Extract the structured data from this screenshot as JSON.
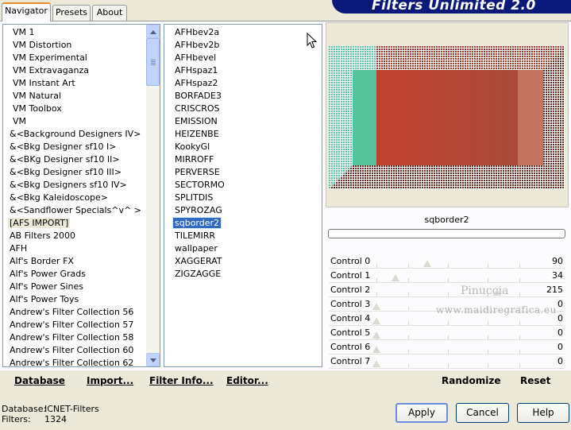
{
  "tabs": [
    "Navigator",
    "Presets",
    "About"
  ],
  "banner_title": "Filters Unlimited 2.0",
  "categories": [
    "VM 1",
    "VM Distortion",
    "VM Experimental",
    "VM Extravaganza",
    "VM Instant Art",
    "VM Natural",
    "VM Toolbox",
    "VM",
    "&<Background Designers IV>",
    "&<Bkg Designer sf10 I>",
    "&<BKg Designer sf10 II>",
    "&<Bkg Designer sf10 III>",
    "&<Bkg Designers sf10 IV>",
    "&<Bkg Kaleidoscope>",
    "&<Sandflower Specials^v^ >",
    "[AFS IMPORT]",
    "AB Filters 2000",
    "AFH",
    "Alf's Border FX",
    "Alf's Power Grads",
    "Alf's Power Sines",
    "Alf's Power Toys",
    "Andrew's Filter Collection 56",
    "Andrew's Filter Collection 57",
    "Andrew's Filter Collection 58",
    "Andrew's Filter Collection 60",
    "Andrew's Filter Collection 62"
  ],
  "filters": [
    "AFHbev2a",
    "AFHbev2b",
    "AFHbevel",
    "AFHspaz1",
    "AFHspaz2",
    "BORFADE3",
    "CRISCROS",
    "EMISSION",
    "HEIZENBE",
    "KookyGl",
    "MIRROFF",
    "PERVERSE",
    "SECTORMO",
    "SPLITDIS",
    "SPYROZAG",
    "sqborder2",
    "TILEMIRR",
    "wallpaper",
    "XAGGERAT",
    "ZIGZAGGE"
  ],
  "selected_filter_name": "sqborder2",
  "controls": [
    {
      "label": "Control 0",
      "value": "90",
      "level": 0.353
    },
    {
      "label": "Control 1",
      "value": "34",
      "level": 0.133
    },
    {
      "label": "Control 2",
      "value": "215",
      "level": 0.843
    },
    {
      "label": "Control 3",
      "value": "0",
      "level": 0
    },
    {
      "label": "Control 4",
      "value": "0",
      "level": 0
    },
    {
      "label": "Control 5",
      "value": "0",
      "level": 0
    },
    {
      "label": "Control 6",
      "value": "0",
      "level": 0
    },
    {
      "label": "Control 7",
      "value": "0",
      "level": 0
    }
  ],
  "watermark": {
    "line1": "Pinuccia",
    "line2": "www.maidiregrafica.eu"
  },
  "bottom_bar": {
    "database": "Database",
    "import": "Import...",
    "filter_info": "Filter Info...",
    "editor": "Editor...",
    "randomize": "Randomize",
    "reset": "Reset"
  },
  "status": {
    "database_label": "Database:",
    "database_value": "ICNET-Filters",
    "filters_label": "Filters:",
    "filters_value": "1324"
  },
  "buttons": {
    "apply": "Apply",
    "cancel": "Cancel",
    "help": "Help"
  },
  "colors": {
    "selection": "#316ac5",
    "preview_red": "#b34a35",
    "preview_teal": "#4fc39a"
  }
}
